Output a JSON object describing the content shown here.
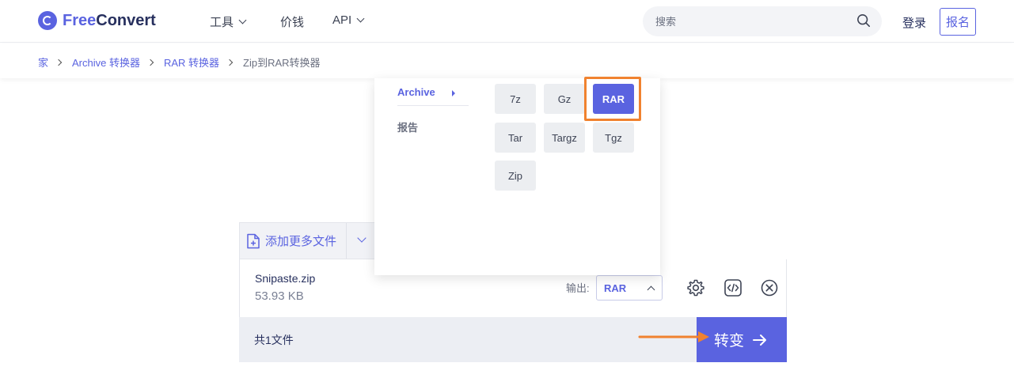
{
  "header": {
    "brand_free": "Free",
    "brand_convert": "Convert",
    "nav": {
      "tools": "工具",
      "pricing": "价钱",
      "api": "API"
    },
    "search_placeholder": "搜索",
    "login": "登录",
    "signup": "报名"
  },
  "breadcrumb": {
    "items": [
      "家",
      "Archive 转换器",
      "RAR 转换器"
    ],
    "current": "Zip到RAR转换器"
  },
  "format_dropdown": {
    "categories": {
      "archive": "Archive",
      "report": "报告"
    },
    "formats": [
      "7z",
      "Gz",
      "RAR",
      "Tar",
      "Targz",
      "Tgz",
      "Zip"
    ],
    "selected": "RAR"
  },
  "upload": {
    "add_more": "添加更多文件"
  },
  "file": {
    "name": "Snipaste.zip",
    "size": "53.93 KB",
    "output_label": "输出:",
    "output_value": "RAR"
  },
  "footer": {
    "total": "共1文件",
    "convert": "转变"
  },
  "colors": {
    "accent": "#5a63e0",
    "highlight": "#f0822f"
  },
  "icons": [
    "logo-icon",
    "chevron-down-icon",
    "search-icon",
    "file-add-icon",
    "gear-icon",
    "code-icon",
    "close-circle-icon",
    "arrow-right-icon"
  ]
}
